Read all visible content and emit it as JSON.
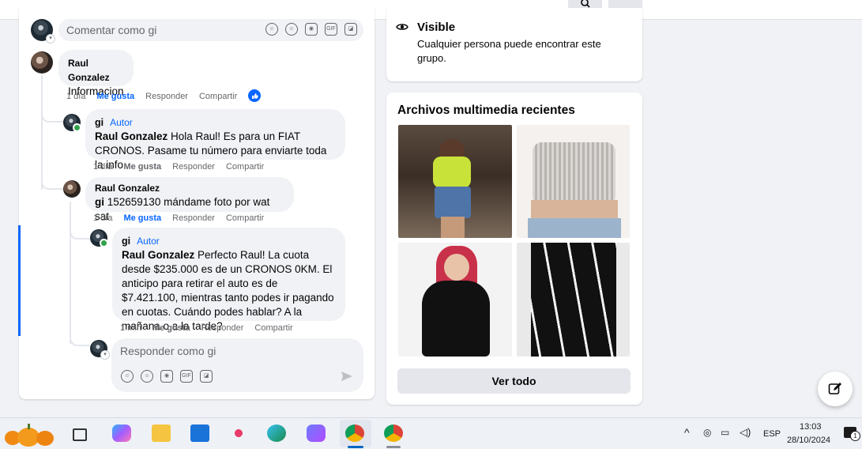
{
  "comment_box": {
    "placeholder": "Comentar como gi"
  },
  "comments": [
    {
      "author": "Raul Gonzalez",
      "text": "Informacion",
      "time": "1 día",
      "like": "Me gusta",
      "reply": "Responder",
      "share": "Compartir"
    },
    {
      "author": "gi",
      "badge": "Autor",
      "mention": "Raul Gonzalez",
      "text": " Hola Raul! Es para un FIAT CRONOS. Pasame tu número para enviarte toda la info",
      "time": "1 día",
      "like": "Me gusta",
      "reply": "Responder",
      "share": "Compartir"
    },
    {
      "author": "Raul Gonzalez",
      "mention": "gi",
      "text": " 152659130 mándame foto por wat sat",
      "time": "1 día",
      "like": "Me gusta",
      "reply": "Responder",
      "share": "Compartir"
    },
    {
      "author": "gi",
      "badge": "Autor",
      "mention": "Raul Gonzalez",
      "text": " Perfecto Raul! La cuota desde $235.000 es de un CRONOS 0KM. El anticipo para retirar el auto es de $7.421.100, mientras tanto podes ir pagando en cuotas. Cuándo podes hablar? A la mañana o a la tarde?",
      "time": "1 min",
      "like": "Me gusta",
      "reply": "Responder",
      "share": "Compartir"
    }
  ],
  "reply_box": {
    "placeholder": "Responder como gi"
  },
  "about": {
    "title": "Visible",
    "description": "Cualquier persona puede encontrar este grupo."
  },
  "media": {
    "title": "Archivos multimedia recientes",
    "button": "Ver todo"
  },
  "taskbar": {
    "lang": "ESP",
    "time": "13:03",
    "date": "28/10/2024",
    "notif_count": "1"
  },
  "colors": {
    "accent": "#0866ff",
    "bg": "#f0f2f5"
  },
  "icons": [
    "search-icon",
    "eye-icon",
    "emoji-icon",
    "camera-icon",
    "gif-icon",
    "sticker-icon",
    "send-icon",
    "like-icon",
    "edit-icon"
  ]
}
